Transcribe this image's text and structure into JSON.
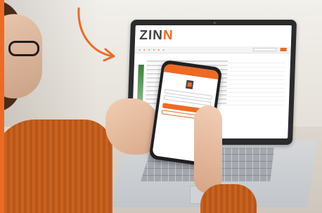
{
  "laptop": {
    "logo_text": "ZIN",
    "logo_accent": "N",
    "nav_items": [
      "",
      "",
      "",
      "",
      "",
      ""
    ],
    "section_title": "",
    "row_values": [
      "",
      "",
      "",
      "",
      "",
      "",
      "",
      "",
      "",
      "",
      ""
    ]
  },
  "phone": {
    "topbar_label": "",
    "heading": "",
    "field_labels": [
      "",
      ""
    ],
    "primary_button": "",
    "secondary_button": ""
  },
  "colors": {
    "accent": "#ee6a24",
    "laptop_frame": "#2b2b2d",
    "sweater": "#c8621f"
  },
  "icons": [
    "arrow-curved-icon"
  ]
}
